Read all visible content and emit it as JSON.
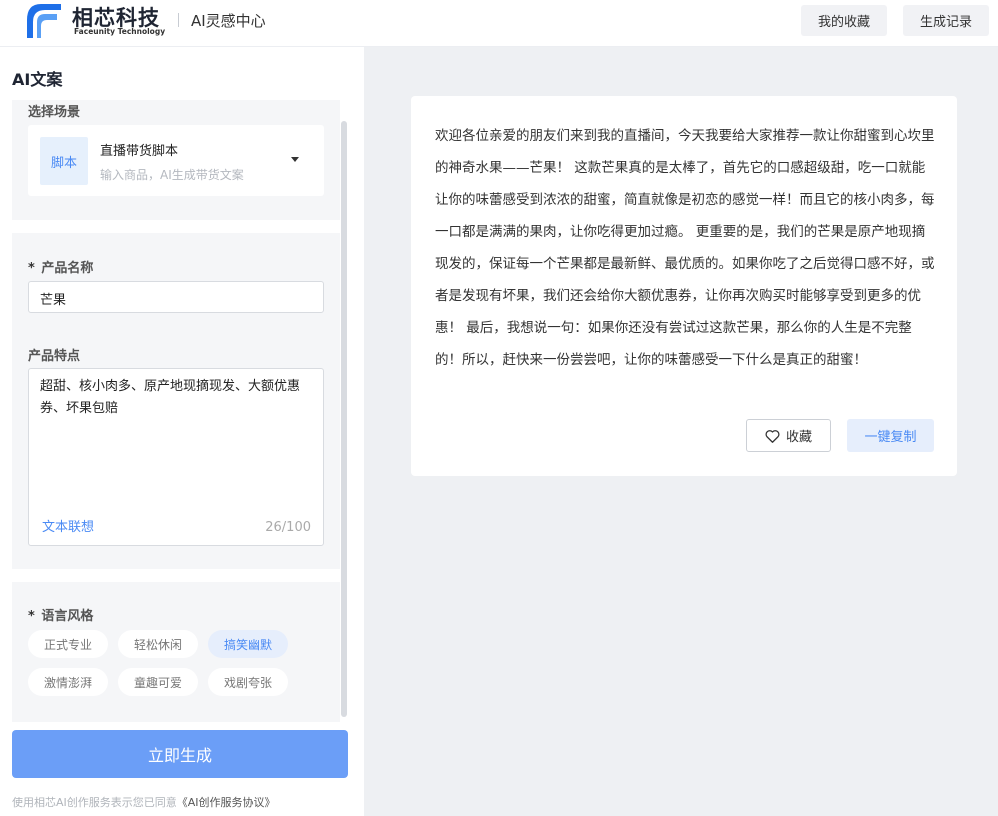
{
  "header": {
    "brand_name": "相芯科技",
    "brand_sub": "Faceunity Technology",
    "app_title": "AI灵感中心",
    "favorites_label": "我的收藏",
    "records_label": "生成记录",
    "brand_color": "#1e6fe8"
  },
  "left": {
    "section_title": "AI文案",
    "scene": {
      "label": "选择场景",
      "badge": "脚本",
      "name": "直播带货脚本",
      "description": "输入商品，AI生成带货文案"
    },
    "product_name": {
      "required_mark": "*",
      "label": "产品名称",
      "value": "芒果"
    },
    "features": {
      "label": "产品特点",
      "value": "超甜、核小肉多、原产地现摘现发、大额优惠券、坏果包赔",
      "assist_link": "文本联想",
      "count": "26/100"
    },
    "style": {
      "required_mark": "*",
      "label": "语言风格",
      "tags": [
        "正式专业",
        "轻松休闲",
        "搞笑幽默",
        "激情澎湃",
        "童趣可爱",
        "戏剧夸张"
      ],
      "selected": "搞笑幽默"
    },
    "generate_label": "立即生成",
    "agreement_prefix": "使用相芯AI创作服务表示您已同意",
    "agreement_doc": "《AI创作服务协议》"
  },
  "result": {
    "text": "欢迎各位亲爱的朋友们来到我的直播间，今天我要给大家推荐一款让你甜蜜到心坎里的神奇水果——芒果！ 这款芒果真的是太棒了，首先它的口感超级甜，吃一口就能让你的味蕾感受到浓浓的甜蜜，简直就像是初恋的感觉一样！而且它的核小肉多，每一口都是满满的果肉，让你吃得更加过瘾。 更重要的是，我们的芒果是原产地现摘现发的，保证每一个芒果都是最新鲜、最优质的。如果你吃了之后觉得口感不好，或者是发现有坏果，我们还会给你大额优惠券，让你再次购买时能够享受到更多的优惠！ 最后，我想说一句：如果你还没有尝试过这款芒果，那么你的人生是不完整的！所以，赶快来一份尝尝吧，让你的味蕾感受一下什么是真正的甜蜜！",
    "favorite_label": "收藏",
    "copy_label": "一键复制"
  },
  "colors": {
    "accent": "#4a8af4",
    "generate_button": "#6b9ef7",
    "page_background": "#eef0f3"
  }
}
